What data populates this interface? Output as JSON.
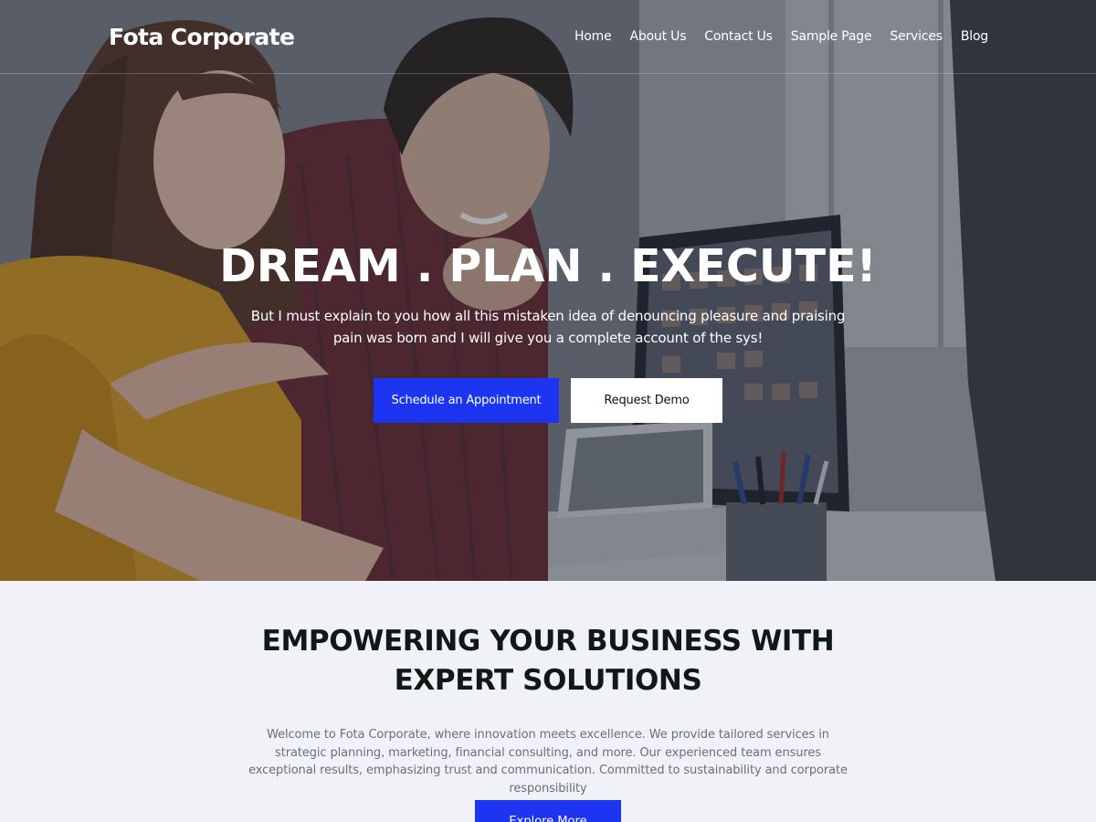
{
  "site": {
    "logo": "Fota Corporate"
  },
  "nav": {
    "items": [
      "Home",
      "About Us",
      "Contact Us",
      "Sample Page",
      "Services",
      "Blog"
    ]
  },
  "hero": {
    "title": "DREAM . PLAN . EXECUTE!",
    "subtitle": "But I must explain to you how all this mistaken idea of denouncing pleasure and praising pain was born and I will give you a complete account of the sys!",
    "primary_button": "Schedule an Appointment",
    "secondary_button": "Request Demo"
  },
  "intro": {
    "title": "EMPOWERING YOUR BUSINESS WITH EXPERT SOLUTIONS",
    "text": "Welcome to Fota Corporate, where innovation meets excellence. We provide tailored services in strategic planning, marketing, financial consulting, and more. Our experienced team ensures exceptional results, emphasizing trust and communication. Committed to sustainability and corporate responsibility",
    "button": "Explore More"
  },
  "colors": {
    "accent": "#1d34f0",
    "section_bg": "#f1f2f7",
    "heading": "#0f1a16",
    "body_text": "#6b6f77"
  }
}
